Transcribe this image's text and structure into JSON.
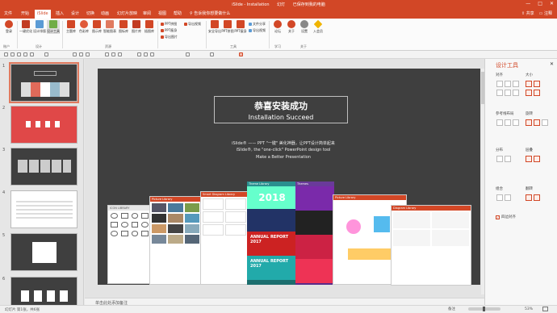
{
  "window": {
    "title_parts": [
      "iSlide - Installation",
      "幻灯",
      "已保存到我的电脑"
    ],
    "controls": [
      "—",
      "□",
      "✕"
    ]
  },
  "tabs": [
    "文件",
    "开始",
    "iSlide",
    "插入",
    "设计",
    "切换",
    "动画",
    "幻灯片放映",
    "审阅",
    "视图",
    "帮助",
    "告诉我你想要做什么"
  ],
  "active_tab": "iSlide",
  "tabs_right": {
    "share": "共享",
    "comment": "注释"
  },
  "ribbon": {
    "buttons": [
      {
        "label": "登录",
        "icon": "user-icon",
        "color": "#d24726"
      },
      {
        "label": "一键优化",
        "icon": "wand-icon",
        "color": "#c23b22"
      },
      {
        "label": "设计排版",
        "icon": "layout-icon",
        "color": "#5b9bd5"
      },
      {
        "label": "设计工具",
        "icon": "tool-icon",
        "color": "#70ad47"
      },
      {
        "label": "主题库",
        "icon": "theme-icon",
        "color": "#d24726"
      },
      {
        "label": "色彩库",
        "icon": "palette-icon",
        "color": "#e05a3a"
      },
      {
        "label": "图示库",
        "icon": "diagram-icon",
        "color": "#d24726"
      },
      {
        "label": "智能图表",
        "icon": "chart-icon",
        "color": "#e07a5f"
      },
      {
        "label": "图标库",
        "icon": "icons-icon",
        "color": "#d24726"
      },
      {
        "label": "图片库",
        "icon": "picture-icon",
        "color": "#c23b22"
      },
      {
        "label": "插图库",
        "icon": "illustration-icon",
        "color": "#d24726"
      }
    ],
    "small_items": [
      "PPT拼图",
      "PPT瘦身",
      "导出图片",
      "导出视频"
    ],
    "right_buttons": [
      {
        "label": "安全导出",
        "icon": "shield-icon",
        "color": "#d24726"
      },
      {
        "label": "PPT拼图",
        "icon": "puzzle-icon",
        "color": "#d24726"
      },
      {
        "label": "PPT瘦身",
        "icon": "slim-icon",
        "color": "#d24726"
      },
      {
        "label": "文件分享",
        "icon": "share-icon",
        "color": "#5b9bd5"
      },
      {
        "label": "导出视频",
        "icon": "video-icon",
        "color": "#5b9bd5"
      },
      {
        "label": "论坛",
        "icon": "forum-icon",
        "color": "#d24726"
      },
      {
        "label": "关于",
        "icon": "info-icon",
        "color": "#d24726"
      },
      {
        "label": "设置",
        "icon": "gear-icon",
        "color": "#888888"
      },
      {
        "label": "入会员",
        "icon": "vip-icon",
        "color": "#f0b400"
      }
    ],
    "groups": [
      "账户",
      "设计",
      "资源",
      "工具",
      "学习",
      "关于"
    ]
  },
  "thumbnails": [
    {
      "num": "1",
      "style": "dark"
    },
    {
      "num": "2",
      "style": "red"
    },
    {
      "num": "3",
      "style": "dark"
    },
    {
      "num": "4",
      "style": "light"
    },
    {
      "num": "5",
      "style": "dark"
    },
    {
      "num": "6",
      "style": "dark"
    }
  ],
  "slide": {
    "title_cn": "恭喜安装成功",
    "title_en": "Installation Succeed",
    "desc_cn": "iSlide® —— PPT \"一键\" 美化神器，让PPT设计简单起来",
    "desc_en": "iSlide®, the \"one-click\" PowerPoint design tool",
    "desc_en2": "Make a Better Presentation",
    "windows": [
      {
        "title": "ICON LIBRARY"
      },
      {
        "title": "Picture Library"
      },
      {
        "title": "Smart Diagram Library"
      },
      {
        "title": "Theme Library"
      },
      {
        "title": "Themes"
      },
      {
        "title": "Picture Library"
      },
      {
        "title": "Diagram Library"
      }
    ],
    "annual_text": "ANNUAL REPORT 2017"
  },
  "notes_placeholder": "单击此处添加备注",
  "status": {
    "slide": "幻灯片 第1张，共6张",
    "notes": "备注",
    "zoom": "53%"
  },
  "right_panel": {
    "title": "设计工具",
    "sections": [
      "对齐",
      "大小",
      "参考线布局",
      "旋转",
      "分布",
      "层叠",
      "组合",
      "翻转",
      "四边对齐"
    ]
  },
  "colors": {
    "accent": "#d24726",
    "slide_bg": "#3f3f3f"
  }
}
